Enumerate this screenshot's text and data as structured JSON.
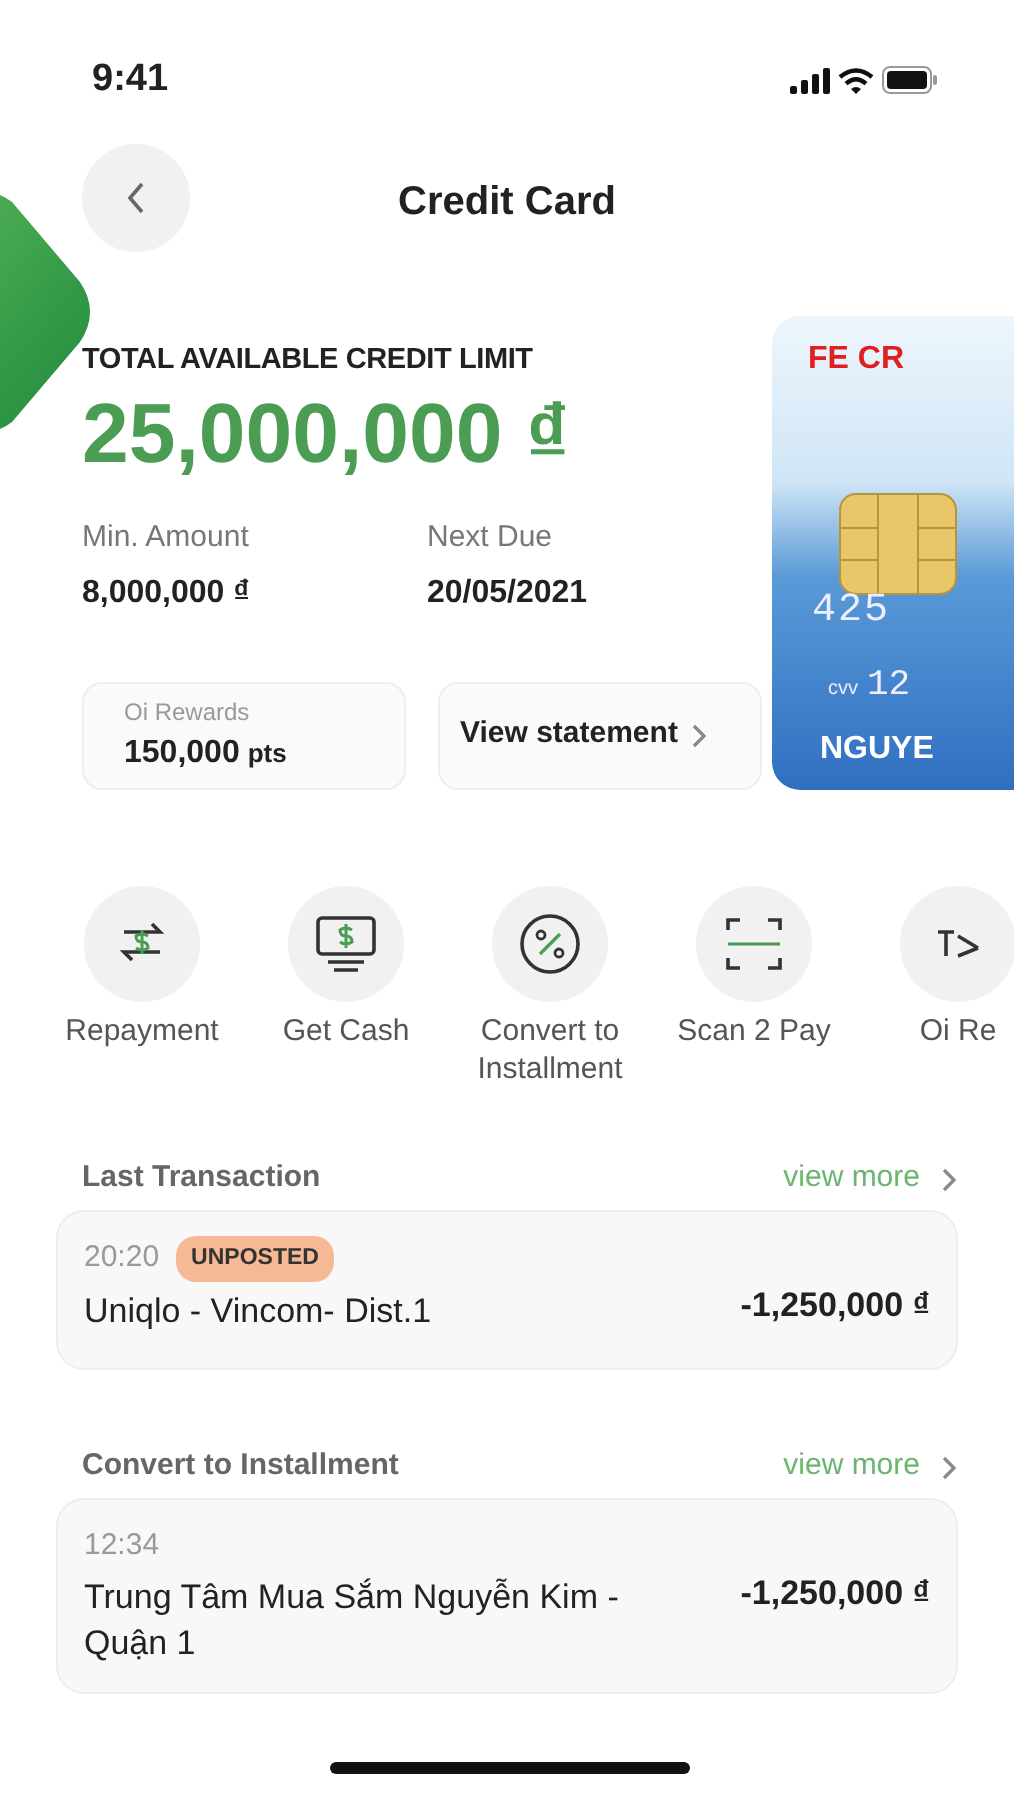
{
  "status_bar": {
    "time": "9:41"
  },
  "header": {
    "title": "Credit Card"
  },
  "credit": {
    "label": "TOTAL AVAILABLE CREDIT LIMIT",
    "amount": "25,000,000 ₫"
  },
  "summary": [
    {
      "label": "Min. Amount",
      "value": "8,000,000 ₫"
    },
    {
      "label": "Next Due",
      "value": "20/05/2021"
    }
  ],
  "rewards": {
    "label": "Oi Rewards",
    "points": "150,000",
    "unit": "pts"
  },
  "statement_button": {
    "label": "View statement"
  },
  "card": {
    "brand": "FE CR",
    "number": "425",
    "cvv_label": "cvv",
    "cvv": "12",
    "holder": "NGUYE"
  },
  "actions": [
    {
      "kind": "repayment",
      "label": "Repayment"
    },
    {
      "kind": "cash",
      "label": "Get Cash"
    },
    {
      "kind": "percent",
      "label": "Convert to Installment"
    },
    {
      "kind": "scan",
      "label": "Scan 2 Pay"
    },
    {
      "kind": "rewards",
      "label": "Oi Re"
    }
  ],
  "sections": [
    {
      "title": "Last Transaction",
      "link": "view more",
      "transactions": [
        {
          "time": "20:20",
          "badge": "UNPOSTED",
          "merchant": "Uniqlo - Vincom- Dist.1",
          "amount": "-1,250,000 ₫"
        }
      ]
    },
    {
      "title": "Convert to Installment",
      "link": "view more",
      "transactions": [
        {
          "time": "12:34",
          "merchant": "Trung Tâm Mua Sắm Nguyễn Kim - Quận 1",
          "amount": "-1,250,000 ₫"
        }
      ]
    }
  ]
}
